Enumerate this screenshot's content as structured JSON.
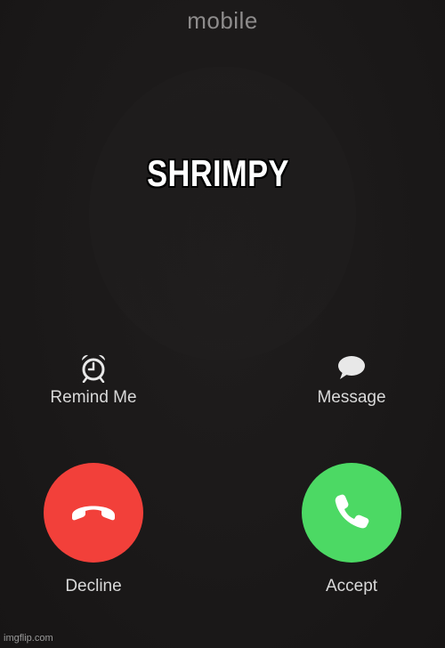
{
  "call": {
    "type": "mobile",
    "caller_name": "SHRIMPY"
  },
  "options": {
    "remind_label": "Remind Me",
    "remind_icon": "alarm-clock-icon",
    "message_label": "Message",
    "message_icon": "speech-bubble-icon"
  },
  "actions": {
    "decline_label": "Decline",
    "decline_icon": "phone-hangup-icon",
    "decline_color": "#f2403a",
    "accept_label": "Accept",
    "accept_icon": "phone-icon",
    "accept_color": "#4cd964"
  },
  "watermark": "imgflip.com"
}
